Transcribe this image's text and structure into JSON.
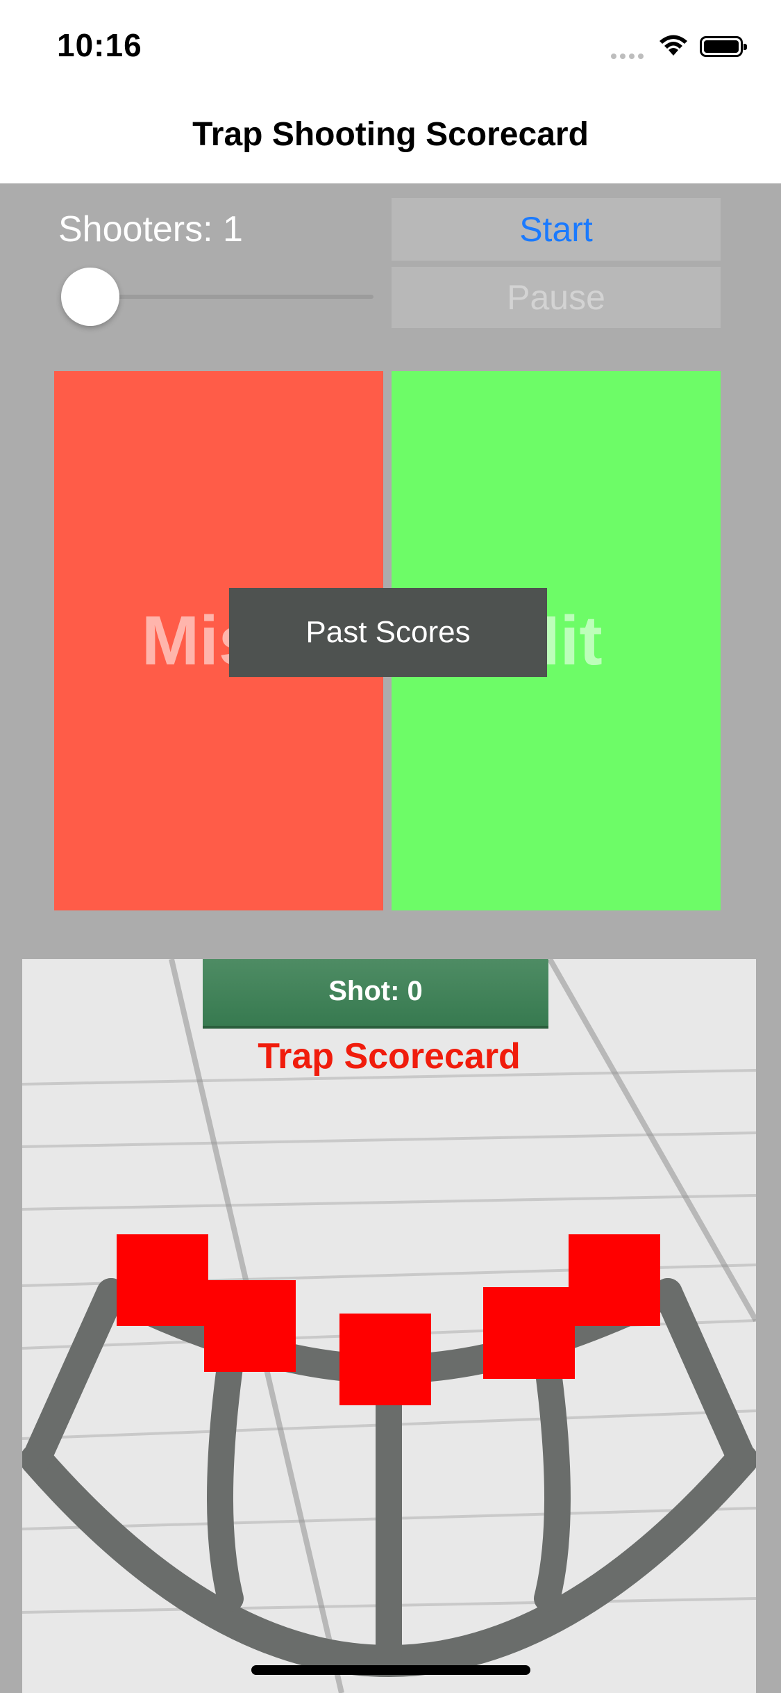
{
  "status": {
    "time": "10:16"
  },
  "nav": {
    "title": "Trap Shooting Scorecard"
  },
  "controls": {
    "shooters_label": "Shooters: 1",
    "shooters_slider_value": 1,
    "start_label": "Start",
    "pause_label": "Pause"
  },
  "panels": {
    "miss_label": "Miss",
    "hit_label": "Hit",
    "past_scores_label": "Past Scores"
  },
  "scorecard": {
    "shot_label": "Shot: 0",
    "title": "Trap Scorecard",
    "station_count": 5
  },
  "colors": {
    "miss": "#ff5c48",
    "hit": "#6dfc67",
    "accent": "#1a7aff",
    "station_marker": "#ff0000",
    "title_red": "#f01c0c"
  }
}
